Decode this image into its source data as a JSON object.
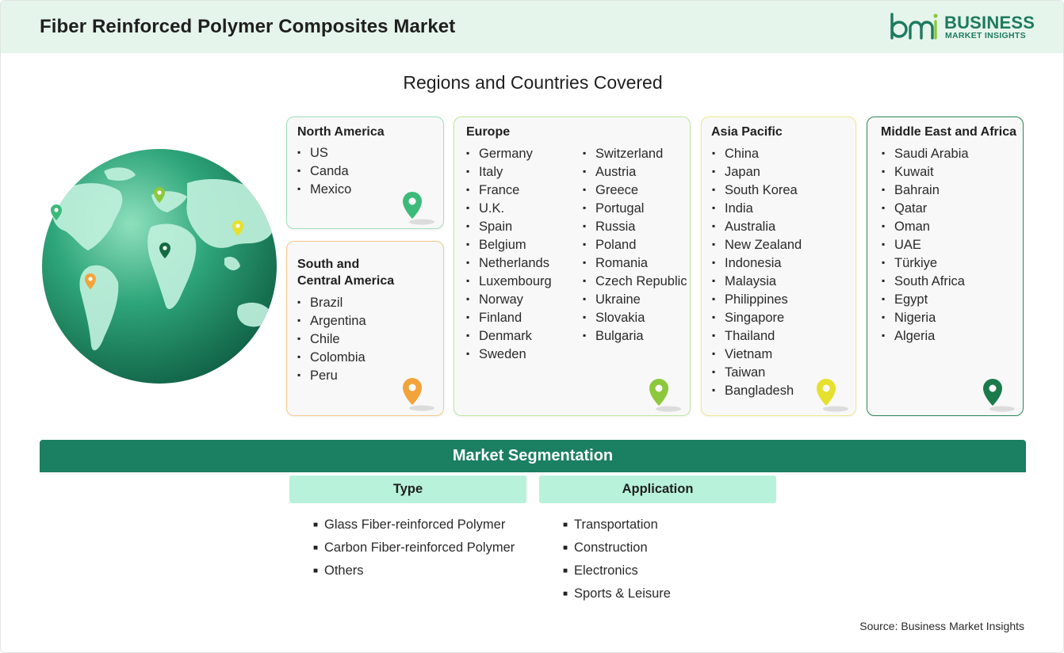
{
  "header": {
    "title": "Fiber Reinforced Polymer Composites Market"
  },
  "logo": {
    "line1": "BUSINESS",
    "line2": "MARKET INSIGHTS",
    "mark_alt": "bmi"
  },
  "subtitle": "Regions and Countries Covered",
  "regions": {
    "north_america": {
      "title": "North America",
      "countries": [
        "US",
        "Canda",
        "Mexico"
      ],
      "pin_color": "#3cba7a"
    },
    "south_central_america": {
      "title": "South and\nCentral America",
      "countries": [
        "Brazil",
        "Argentina",
        "Chile",
        "Colombia",
        "Peru"
      ],
      "pin_color": "#f2a33a"
    },
    "europe": {
      "title": "Europe",
      "countries_col1": [
        "Germany",
        "Italy",
        "France",
        "U.K.",
        "Spain",
        "Belgium",
        "Netherlands",
        "Luxembourg",
        "Norway",
        "Finland",
        "Denmark",
        "Sweden"
      ],
      "countries_col2": [
        "Switzerland",
        "Austria",
        "Greece",
        "Portugal",
        "Russia",
        "Poland",
        "Romania",
        "Czech Republic",
        "Ukraine",
        "Slovakia",
        "Bulgaria"
      ],
      "pin_color": "#8cc83c"
    },
    "asia_pacific": {
      "title": "Asia Pacific",
      "countries": [
        "China",
        "Japan",
        "South Korea",
        "India",
        "Australia",
        "New Zealand",
        "Indonesia",
        "Malaysia",
        "Philippines",
        "Singapore",
        "Thailand",
        "Vietnam",
        "Taiwan",
        "Bangladesh"
      ],
      "pin_color": "#e6e02e"
    },
    "middle_east_africa": {
      "title": "Middle East and Africa",
      "countries": [
        "Saudi Arabia",
        "Kuwait",
        "Bahrain",
        "Qatar",
        "Oman",
        "UAE",
        "Türkiye",
        "South Africa",
        "Egypt",
        "Nigeria",
        "Algeria"
      ],
      "pin_color": "#1b7a4a"
    }
  },
  "segmentation": {
    "title": "Market Segmentation",
    "type": {
      "label": "Type",
      "items": [
        "Glass Fiber-reinforced Polymer",
        "Carbon Fiber-reinforced Polymer",
        "Others"
      ]
    },
    "application": {
      "label": "Application",
      "items": [
        "Transportation",
        "Construction",
        "Electronics",
        "Sports & Leisure"
      ]
    }
  },
  "source": "Source: Business Market Insights",
  "colors": {
    "accent": "#1b7f62",
    "header_bg": "#e6f5ec",
    "seg_head_bg": "#b8f2da"
  }
}
